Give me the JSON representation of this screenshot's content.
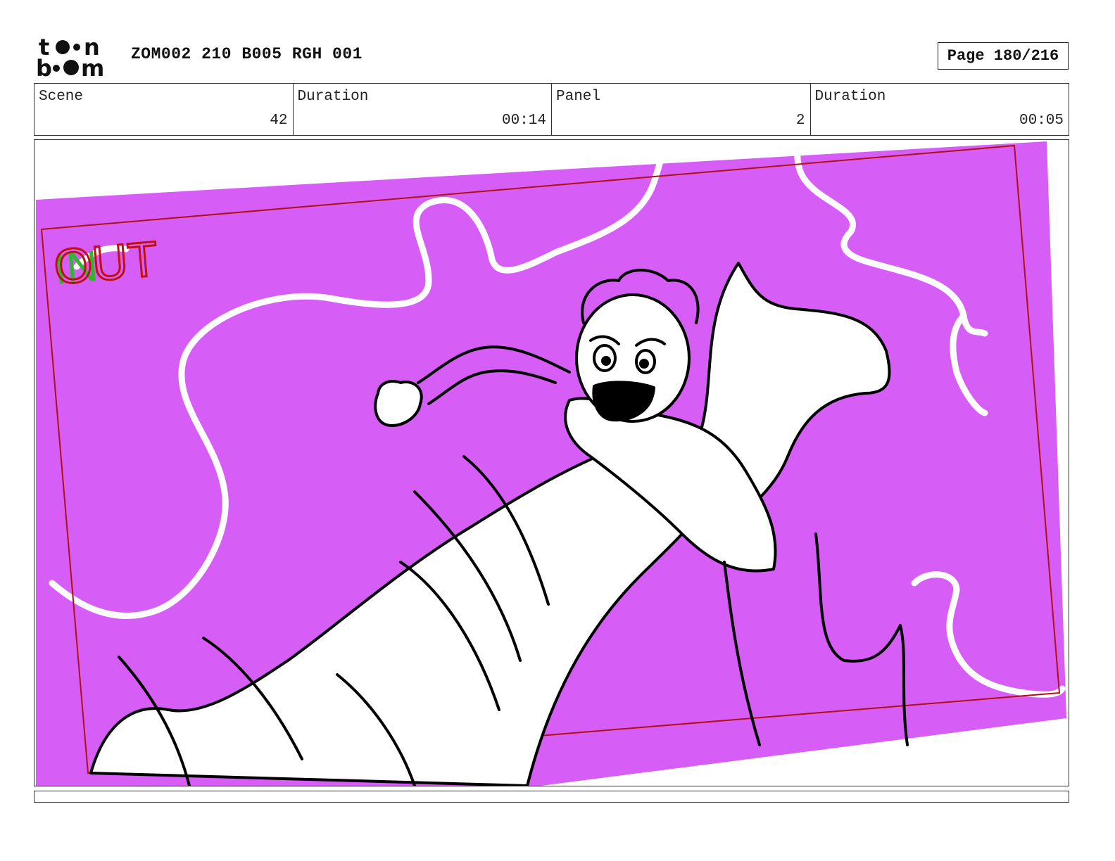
{
  "header": {
    "logo_text": "toon boom",
    "project_title": "ZOM002 210 B005 RGH 001",
    "page_label": "Page 180/216"
  },
  "info": {
    "scene_label": "Scene",
    "scene_value": "42",
    "scene_duration_label": "Duration",
    "scene_duration_value": "00:14",
    "panel_label": "Panel",
    "panel_value": "2",
    "panel_duration_label": "Duration",
    "panel_duration_value": "00:05"
  },
  "panel": {
    "in_marker": "IN",
    "out_marker": "OUT",
    "background_color": "#d65ef7",
    "camera_frame_color": "#b01010",
    "in_marker_color": "#2fb52f",
    "out_marker_color": "#c01010"
  }
}
